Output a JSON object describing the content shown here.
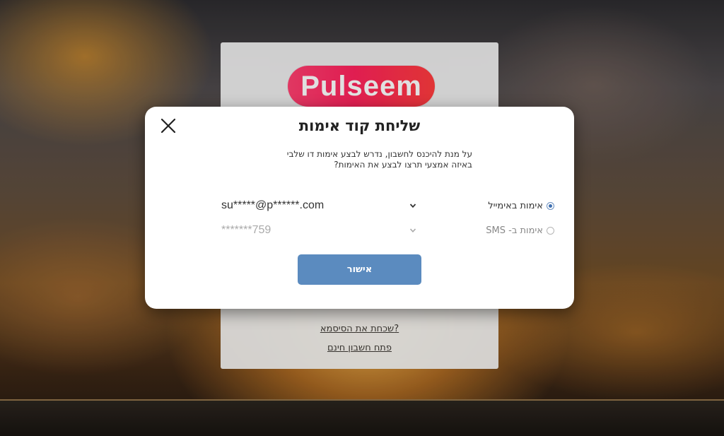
{
  "background_login": {
    "logo_text": "Pulseem",
    "forgot_password_link": "שכחת את הסיסמא?",
    "signup_link": "פתח חשבון חינם"
  },
  "modal": {
    "title": "שליחת קוד אימות",
    "description_line1": "על מנת להיכנס לחשבון, נדרש לבצע אימות דו שלבי",
    "description_line2": "באיזה אמצעי תרצו לבצע את האימות?",
    "close_icon": "close-x-icon",
    "options": [
      {
        "label": "אימות באימייל",
        "value": "su*****@p******.com",
        "selected": true
      },
      {
        "label": "אימות ב- SMS",
        "value": "*******759",
        "selected": false
      }
    ],
    "confirm_button": "אישור"
  },
  "colors": {
    "accent": "#5b8bbf",
    "logo_gradient_start": "#ff3d6e",
    "logo_gradient_end": "#ff3a3a",
    "radio_checked": "#3f6fb0"
  }
}
